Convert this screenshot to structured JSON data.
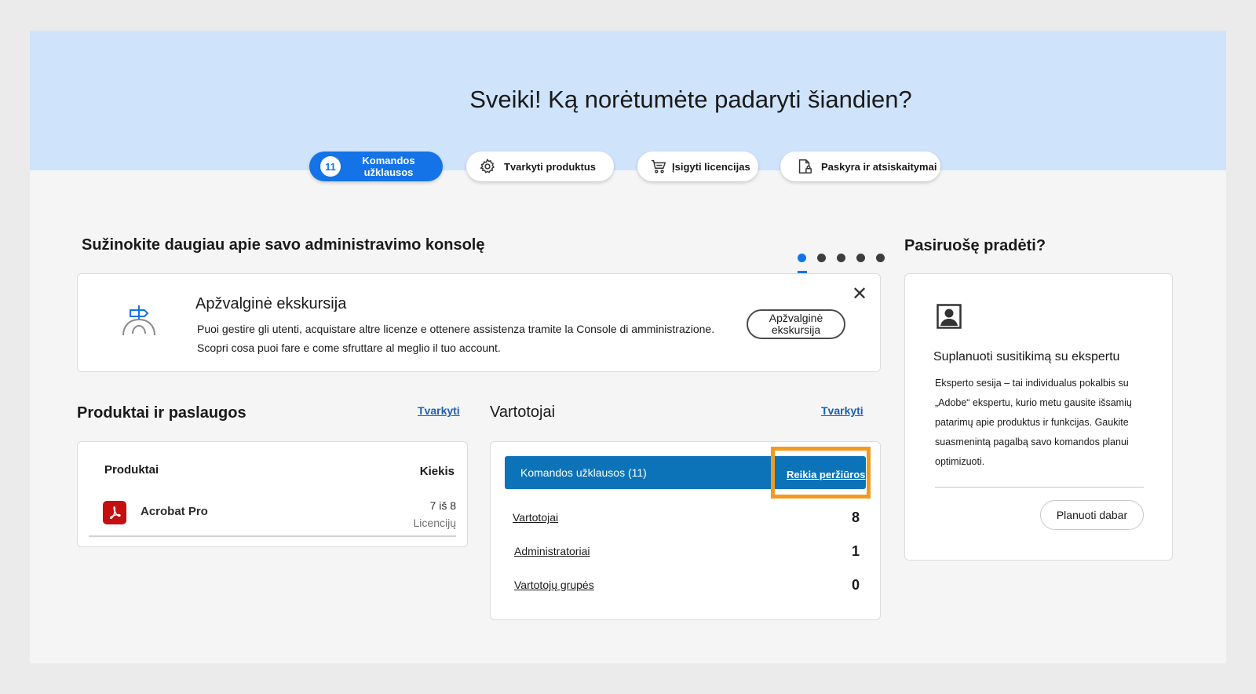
{
  "hero": {
    "title": "Sveiki! Ką norėtumėte padaryti šiandien?"
  },
  "pills": {
    "requests": {
      "badge": "11",
      "line1": "Komandos",
      "line2": "užklausos"
    },
    "manage_products": {
      "label": "Tvarkyti produktus",
      "icon": "gear-icon"
    },
    "buy_licenses": {
      "label": "Įsigyti licencijas",
      "icon": "cart-icon"
    },
    "account_billing": {
      "label": "Paskyra ir atsiskaitymai",
      "icon": "document-lock-icon"
    }
  },
  "learn": {
    "title": "Sužinokite daugiau apie savo administravimo konsolę",
    "tour_title": "Apžvalginė ekskursija",
    "tour_text_1": "Puoi gestire gli utenti, acquistare altre licenze e ottenere assistenza tramite la Console di amministrazione.",
    "tour_text_2": "Scopri cosa puoi fare e come sfruttare al meglio il tuo account.",
    "tour_button_1": "Apžvalginė",
    "tour_button_2": "ekskursija",
    "close": "✕"
  },
  "products": {
    "title": "Produktai ir paslaugos",
    "manage_link": "Tvarkyti",
    "col_products": "Produktai",
    "col_quantity": "Kiekis",
    "items": [
      {
        "name": "Acrobat Pro",
        "qty": "7 iš 8",
        "unit": "Licencijų"
      }
    ]
  },
  "users": {
    "title": "Vartotojai",
    "manage_link": "Tvarkyti",
    "requests_label": "Komandos užklausos (11)",
    "requests_link": "Reikia peržiūros",
    "rows": [
      {
        "label": "Vartotojai",
        "value": "8"
      },
      {
        "label": "Administratoriai",
        "value": "1"
      },
      {
        "label": "Vartotojų grupės",
        "value": "0"
      }
    ]
  },
  "ready": {
    "title": "Pasiruošę pradėti?",
    "card_title": "Suplanuoti susitikimą su ekspertu",
    "card_text": "Eksperto sesija – tai individualus pokalbis su „Adobe“ ekspertu, kurio metu gausite išsamių patarimų apie produktus ir funkcijas. Gaukite suasmenintą pagalbą savo komandos planui optimizuoti.",
    "button": "Planuoti dabar"
  },
  "colors": {
    "primary": "#1473e6",
    "bar": "#0d73b8",
    "highlight": "#f39a1f",
    "hero_bg": "#cfe3fb"
  }
}
